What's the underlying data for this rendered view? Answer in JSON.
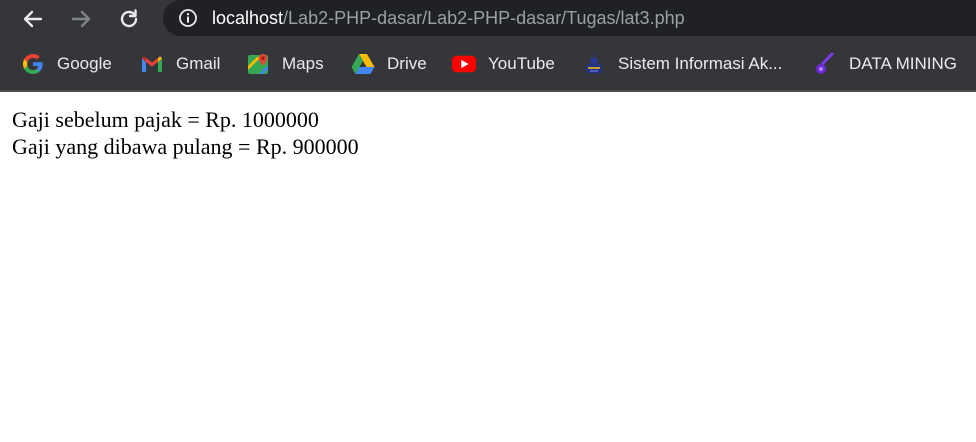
{
  "browser": {
    "url_host": "localhost",
    "url_path": "/Lab2-PHP-dasar/Lab2-PHP-dasar/Tugas/lat3.php"
  },
  "bookmarks": [
    {
      "label": "Google",
      "icon": "google-icon"
    },
    {
      "label": "Gmail",
      "icon": "gmail-icon"
    },
    {
      "label": "Maps",
      "icon": "maps-icon"
    },
    {
      "label": "Drive",
      "icon": "drive-icon"
    },
    {
      "label": "YouTube",
      "icon": "youtube-icon"
    },
    {
      "label": "Sistem Informasi Ak...",
      "icon": "sistem-informasi-icon"
    },
    {
      "label": "DATA MINING",
      "icon": "data-mining-icon"
    }
  ],
  "page": {
    "line1": "Gaji sebelum pajak = Rp. 1000000",
    "line2": "Gaji yang dibawa pulang = Rp. 900000"
  }
}
